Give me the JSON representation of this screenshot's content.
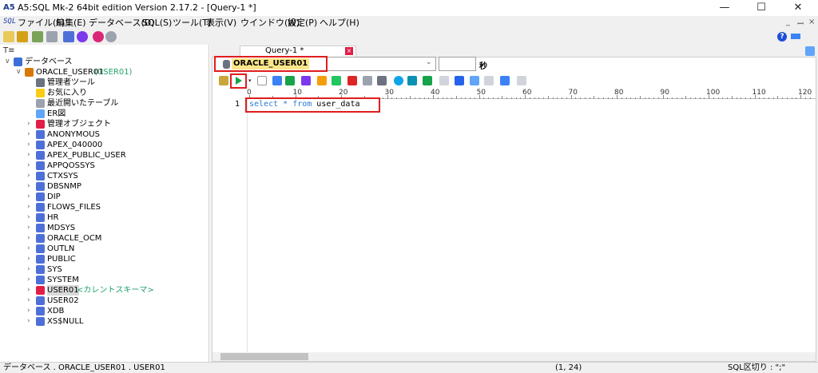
{
  "window": {
    "title": "A5:SQL Mk-2 64bit edition Version 2.17.2 - [Query-1 *]",
    "icon": "A5",
    "controls": [
      "—",
      "☐",
      "✕"
    ]
  },
  "menu": {
    "items": [
      "ファイル(F)",
      "編集(E)",
      "データベース(D)",
      "SQL(S)",
      "ツール(T)",
      "表示(V)",
      "ウインドウ(W)",
      "設定(P)",
      "ヘルプ(H)"
    ],
    "sql_icon": "SQL",
    "mdi": [
      "_",
      "ꟷ",
      "×"
    ]
  },
  "tree": {
    "root": "データベース",
    "connection": {
      "name": "ORACLE_USER01",
      "user": "(USER01)"
    },
    "tools": [
      "管理者ツール",
      "お気に入り",
      "最近開いたテーブル",
      "ER図",
      "管理オブジェクト"
    ],
    "schemas": [
      "ANONYMOUS",
      "APEX_040000",
      "APEX_PUBLIC_USER",
      "APPQOSSYS",
      "CTXSYS",
      "DBSNMP",
      "DIP",
      "FLOWS_FILES",
      "HR",
      "MDSYS",
      "ORACLE_OCM",
      "OUTLN",
      "PUBLIC",
      "SYS",
      "SYSTEM",
      "USER01",
      "USER02",
      "XDB",
      "XS$NULL"
    ],
    "current_schema": "USER01",
    "current_schema_note": "<カレントスキーマ>"
  },
  "query_tab": {
    "label": "Query-1 *"
  },
  "connection_select": {
    "value": "ORACLE_USER01"
  },
  "timeout": {
    "value": "",
    "unit": "秒"
  },
  "ruler": {
    "labels": [
      "0",
      "10",
      "20",
      "30",
      "40",
      "50",
      "60",
      "70",
      "80",
      "90",
      "100",
      "110",
      "120"
    ]
  },
  "editor": {
    "line_number": "1",
    "tokens": [
      {
        "text": "select",
        "kind": "keyword"
      },
      {
        "text": " * ",
        "kind": "op"
      },
      {
        "text": "from",
        "kind": "keyword"
      },
      {
        "text": " user_data",
        "kind": "ident"
      }
    ]
  },
  "status": {
    "path": "データベース . ORACLE_USER01 . USER01",
    "position": "(1, 24)",
    "delimiter": "SQL区切り : \";\""
  },
  "colors": {
    "accent_red": "#e11d1d",
    "keyword": "#2b7bd6",
    "green_label": "#22a06b"
  }
}
